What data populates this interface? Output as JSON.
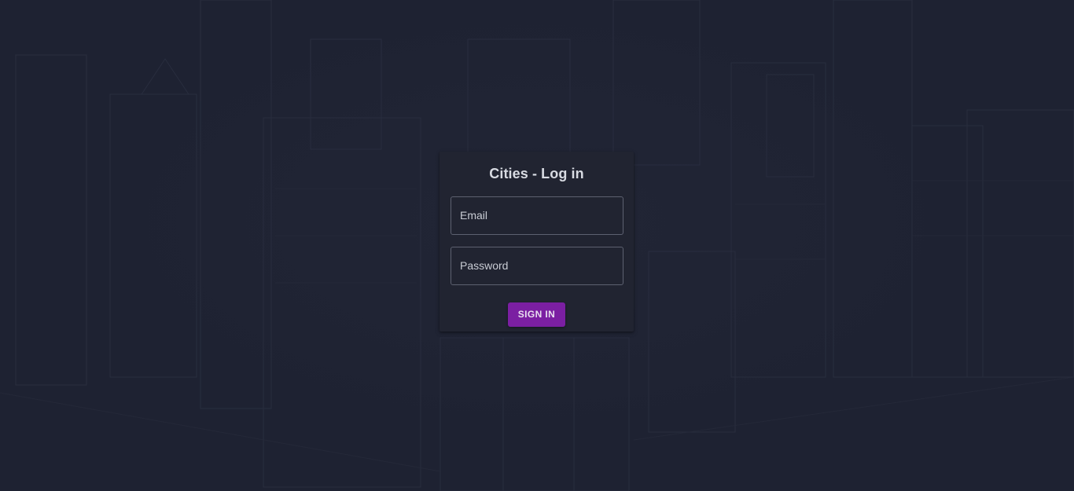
{
  "login": {
    "title": "Cities - Log in",
    "email_label": "Email",
    "password_label": "Password",
    "submit_label": "SIGN IN"
  },
  "colors": {
    "background": "#1e2232",
    "card": "#212431",
    "accent": "#7b1fa2"
  }
}
